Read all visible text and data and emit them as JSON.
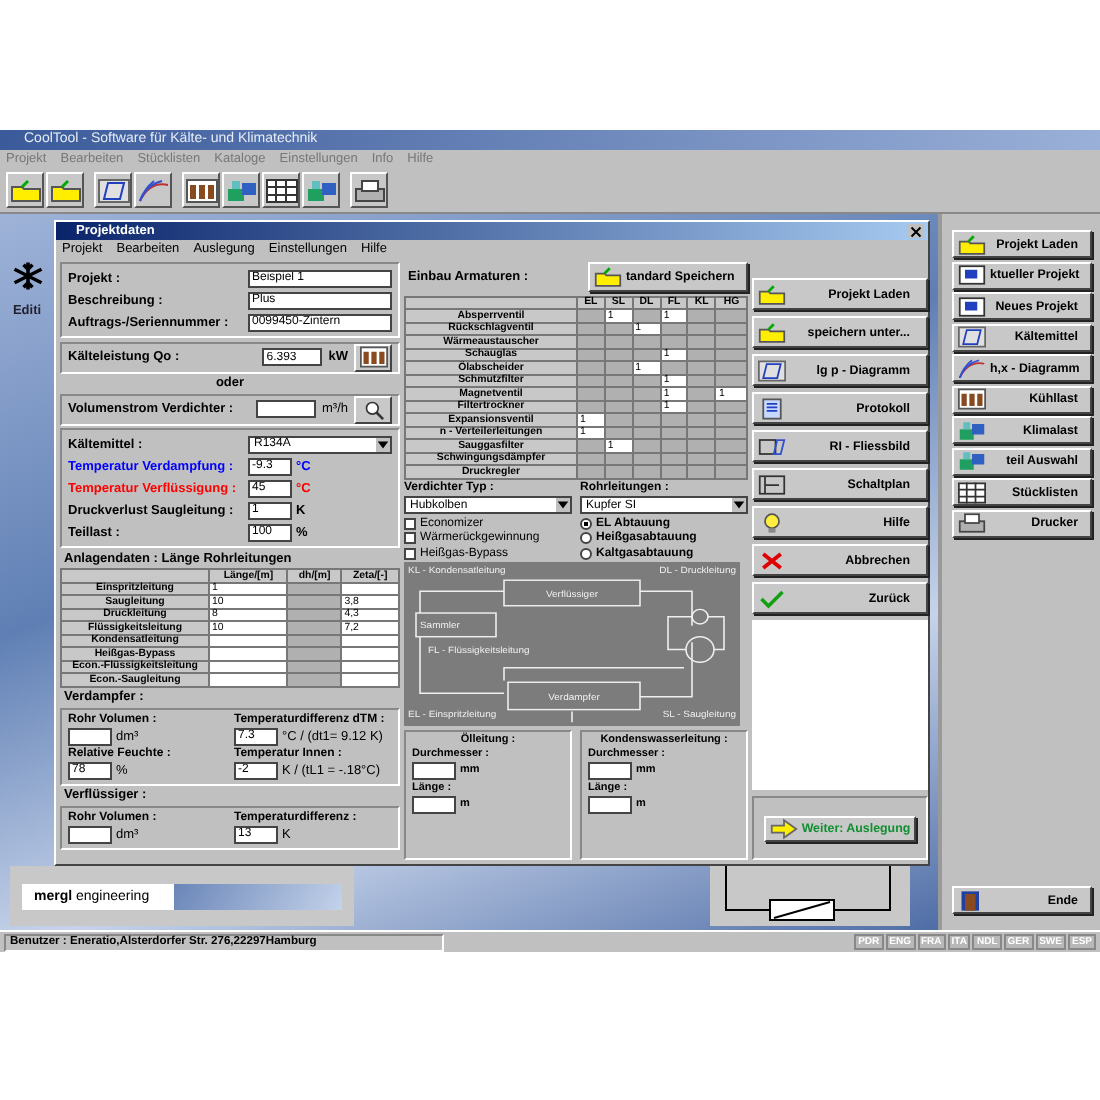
{
  "app": {
    "title": "CoolTool - Software für Kälte- und Klimatechnik",
    "menu": [
      "Projekt",
      "Bearbeiten",
      "Stücklisten",
      "Kataloge",
      "Einstellungen",
      "Info",
      "Hilfe"
    ]
  },
  "background": {
    "caption": "Editi"
  },
  "dialog": {
    "title": "Projektdaten",
    "menu": [
      "Projekt",
      "Bearbeiten",
      "Auslegung",
      "Einstellungen",
      "Hilfe"
    ],
    "project_fields": [
      {
        "label": "Projekt :",
        "value": "Beispiel 1"
      },
      {
        "label": "Beschreibung :",
        "value": "Plus"
      },
      {
        "label": "Auftrags-/Seriennummer :",
        "value": "0099450-Zintern"
      }
    ],
    "capacity": {
      "label": "Kälteleistung Qo  :",
      "value": "6.393",
      "unit": "kW"
    },
    "or": "oder",
    "volume_flow": {
      "label": "Volumenstrom Verdichter :",
      "unit": "m³/h"
    },
    "refrigerant": {
      "label": "Kältemittel :",
      "value": "R134A"
    },
    "conditions": [
      {
        "label": "Temperatur Verdampfung :",
        "value": "-9.3",
        "unit": "°C",
        "color": "#0000ff"
      },
      {
        "label": "Temperatur Verflüssigung :",
        "value": "45",
        "unit": "°C",
        "color": "#ff0000"
      },
      {
        "label": "Druckverlust Saugleitung :",
        "value": "1",
        "unit": "K",
        "color": "#000000"
      },
      {
        "label": "Teillast :",
        "value": "100",
        "unit": "%",
        "color": "#000000"
      }
    ],
    "pipes": {
      "title": "Anlagendaten : Länge Rohrleitungen",
      "columns": [
        "Länge/[m]",
        "dh/[m]",
        "Zeta/[-]"
      ],
      "rows": [
        {
          "name": "Einspritzleitung",
          "length": "1"
        },
        {
          "name": "Saugleitung",
          "length": "10",
          "zeta": "3,8"
        },
        {
          "name": "Druckleitung",
          "length": "8",
          "zeta": "4,3"
        },
        {
          "name": "Flüssigkeitsleitung",
          "length": "10",
          "zeta": "7,2"
        },
        {
          "name": "Kondensatleitung"
        },
        {
          "name": "Heißgas-Bypass"
        },
        {
          "name": "Econ.-Flüssigkeitsleitung"
        },
        {
          "name": "Econ.-Saugleitung"
        }
      ]
    },
    "evaporator": {
      "title": "Verdampfer :",
      "fields": [
        {
          "label": "Rohr Volumen :",
          "unit": "dm³"
        },
        {
          "label": "Temperaturdifferenz dTM :",
          "value": "7.3",
          "unit": "°C / (dt1= 9.12 K)"
        },
        {
          "label": "Relative Feuchte :",
          "value": "78",
          "unit": "%"
        },
        {
          "label": "Temperatur Innen :",
          "value": "-2",
          "unit": "K / (tL1 = -.18°C)"
        }
      ]
    },
    "condenser": {
      "title": "Verflüssiger :",
      "fields": [
        {
          "label": "Rohr Volumen :",
          "unit": "dm³"
        },
        {
          "label": "Temperaturdifferenz :",
          "value": "13",
          "unit": "K"
        }
      ]
    },
    "fittings": {
      "title": "Einbau Armaturen :",
      "save_button": "tandard Speichern",
      "columns": [
        "EL",
        "SL",
        "DL",
        "FL",
        "KL",
        "HG"
      ],
      "rows": [
        {
          "name": "Absperrventil",
          "sl": "1",
          "fl": "1"
        },
        {
          "name": "Rückschlagventil",
          "dl": "1"
        },
        {
          "name": "Wärmeaustauscher"
        },
        {
          "name": "Schauglas",
          "fl": "1"
        },
        {
          "name": "Ölabscheider",
          "dl": "1"
        },
        {
          "name": "Schmutzfilter",
          "fl": "1"
        },
        {
          "name": "Magnetventil",
          "fl": "1",
          "hg": "1"
        },
        {
          "name": "Filtertrockner",
          "fl": "1"
        },
        {
          "name": "Expansionsventil",
          "el": "1"
        },
        {
          "name": "n - Verteilerleitungen",
          "el": "1"
        },
        {
          "name": "Sauggasfilter",
          "sl": "1"
        },
        {
          "name": "Schwingungsdämpfer"
        },
        {
          "name": "Druckregler"
        }
      ]
    },
    "compressor_type": {
      "label": "Verdichter Typ :",
      "value": "Hubkolben"
    },
    "piping": {
      "label": "Rohrleitungen :",
      "value": "Kupfer SI"
    },
    "options": [
      {
        "label": "Economizer",
        "checked": false
      },
      {
        "label": "Wärmerückgewinnung",
        "checked": false
      },
      {
        "label": "Heißgas-Bypass",
        "checked": false
      }
    ],
    "defrost": [
      {
        "label": "EL Abtauung",
        "selected": true
      },
      {
        "label": "Heißgasabtauung",
        "selected": false
      },
      {
        "label": "Kaltgasabtauung",
        "selected": false
      }
    ],
    "diagram": {
      "kl_label": "KL - Kondensatleitung",
      "dl_label": "DL - Druckleitung",
      "condenser": "Verflüssiger",
      "receiver": "Sammler",
      "fl_label": "FL - Flüssigkeitsleitung",
      "evaporator": "Verdampfer",
      "el_label": "EL - Einspritzleitung",
      "sl_label": "SL - Saugleitung"
    },
    "lines": [
      {
        "title": "Ölleitung :",
        "diameter_label": "Durchmesser :",
        "diameter_unit": "mm",
        "length_label": "Länge :",
        "length_unit": "m"
      },
      {
        "title": "Kondenswasserleitung :",
        "diameter_label": "Durchmesser :",
        "diameter_unit": "mm",
        "length_label": "Länge :",
        "length_unit": "m"
      }
    ],
    "actions": [
      "Projekt Laden",
      "speichern unter...",
      "lg p - Diagramm",
      "Protokoll",
      "RI - Fliessbild",
      "Schaltplan",
      "Hilfe",
      "Abbrechen",
      "Zurück"
    ],
    "next_button": "Weiter: Auslegung"
  },
  "sidebar": {
    "buttons": [
      "Projekt Laden",
      "ktueller Projekt",
      "Neues Projekt",
      "Kältemittel",
      "h,x - Diagramm",
      "Kühllast",
      "Klimalast",
      "teil Auswahl",
      "Stücklisten",
      "Drucker"
    ],
    "exit": "Ende"
  },
  "logo": {
    "text": "**mergl** engineering"
  },
  "status_bar": {
    "user": "Benutzer : Eneratio,Alsterdorfer Str. 276,22297Hamburg",
    "languages": [
      "PDR",
      "ENG",
      "FRA",
      "ITA",
      "NDL",
      "GER",
      "SWE",
      "ESP"
    ]
  }
}
